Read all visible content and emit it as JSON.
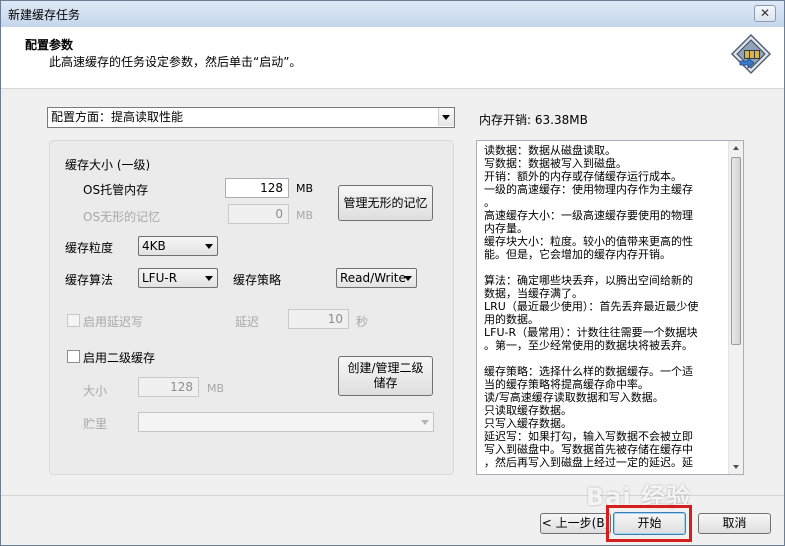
{
  "window": {
    "title": "新建缓存任务",
    "close_glyph": "✕"
  },
  "header": {
    "title": "配置参数",
    "subtitle": "此高速缓存的任务设定参数，然后单击“启动”。",
    "logo_icon": "disk-cache-logo"
  },
  "aspect_select": {
    "value": "配置方面：提高读取性能"
  },
  "memory_overhead": "内存开销: 63.38MB",
  "cache": {
    "section_label": "缓存大小 (一级)",
    "os_managed_label": "OS托管内存",
    "os_managed_value": "128",
    "os_managed_unit": "MB",
    "os_invisible_label": "OS无形的记忆",
    "os_invisible_value": "0",
    "os_invisible_unit": "MB",
    "manage_invisible_button": "管理无形的记忆",
    "granularity_label": "缓存粒度",
    "granularity_value": "4KB",
    "algorithm_label": "缓存算法",
    "algorithm_value": "LFU-R",
    "strategy_label": "缓存策略",
    "strategy_value": "Read/Write",
    "deferred_write_label": "启用延迟写",
    "delay_label": "延迟",
    "delay_value": "10",
    "delay_unit": "秒",
    "l2_label": "启用二级缓存",
    "l2_size_label": "大小",
    "l2_size_value": "128",
    "l2_size_unit": "MB",
    "l2_storage_label": "贮里",
    "l2_button": "创建/管理二级储存"
  },
  "info_lines": [
    "读数据：数据从磁盘读取。",
    "写数据：数据被写入到磁盘。",
    "开销：额外的内存或存储缓存运行成本。",
    " 一级的高速缓存：使用物理内存作为主缓存",
    "。",
    "高速缓存大小：一级高速缓存要使用的物理",
    "内存量。",
    "缓存块大小：粒度。较小的值带来更高的性",
    "能。但是，它会增加的缓存内存开销。",
    "",
    "算法：确定哪些块丢弃，以腾出空间给新的",
    "数据，当缓存满了。",
    "LRU（最近最少使用）：首先丢弃最近最少使",
    "用的数据。",
    "LFU-R（最常用）：计数往往需要一个数据块",
    "。第一，至少经常使用的数据块将被丢弃。",
    "",
    "缓存策略：选择什么样的数据缓存。一个适",
    "当的缓存策略将提高缓存命中率。",
    "读/写高速缓存读取数据和写入数据。",
    "只读取缓存数据。",
    "只写入缓存数据。",
    "延迟写：如果打勾，输入写数据不会被立即",
    "写入到磁盘中。写数据首先被存储在缓存中",
    "，然后再写入到磁盘上经过一定的延迟。延"
  ],
  "footer": {
    "back_button": "< 上一步(B)",
    "start_button": "开始",
    "cancel_button": "取消",
    "watermark": "Bai 经验"
  },
  "colors": {
    "highlight": "#d41f1f",
    "title_bar": "#c5d6ec"
  }
}
